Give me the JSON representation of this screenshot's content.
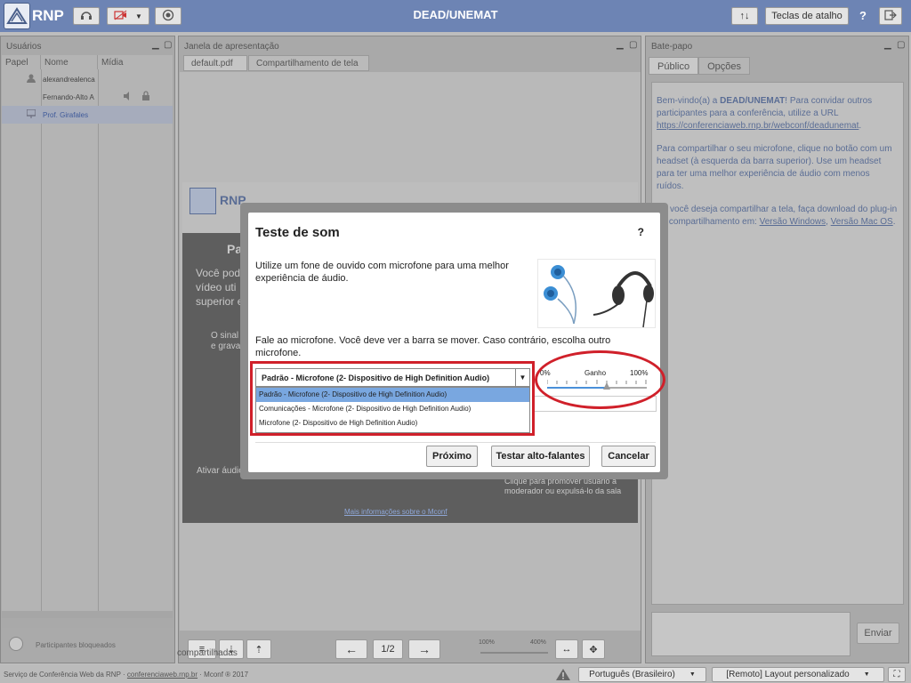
{
  "header": {
    "logo_text": "RNP",
    "title": "DEAD/UNEMAT",
    "shortcuts_label": "Teclas de atalho",
    "help_label": "?"
  },
  "users_panel": {
    "title": "Usuários",
    "columns": [
      "Papel",
      "Nome",
      "Mídia"
    ],
    "rows": [
      {
        "name": "alexandrealenca"
      },
      {
        "name": "Fernando-Alto A"
      },
      {
        "name": "Prof. Girafales"
      }
    ],
    "blocked_label": "Participantes bloqueados"
  },
  "presentation_panel": {
    "title": "Janela de apresentação",
    "tabs": [
      "default.pdf",
      "Compartilhamento de tela"
    ],
    "page_indicator": "1/2",
    "zoom_min": "100%",
    "zoom_max": "400%",
    "shared_label": "compartilhadas",
    "slide": {
      "logo_text": "RNP",
      "lines": [
        "Pa",
        "Você pode",
        "vídeo  uti",
        "superior e",
        "O sinal",
        "e grava",
        "Ativar áudio"
      ],
      "promote_text": "Clique para promover usuário a moderador ou expulsá-lo da sala",
      "more_info": "Mais informações sobre o Mconf"
    }
  },
  "chat_panel": {
    "title": "Bate-papo",
    "tabs": [
      "Público",
      "Opções"
    ],
    "welcome_prefix": "Bem-vindo(a) a ",
    "welcome_room": "DEAD/UNEMAT",
    "welcome_suffix": "! Para convidar outros participantes para a conferência, utilize a URL",
    "welcome_url": "https://conferenciaweb.rnp.br/webconf/deadunemat",
    "mic_tip": "Para compartilhar o seu microfone, clique no botão com um headset (à esquerda da barra superior). Use um headset para ter uma melhor experiência de áudio com menos ruídos.",
    "share_tip": "Se você deseja compartilhar a tela, faça download do plug-in de compartilhamento em:",
    "win_link": "Versão Windows",
    "mac_link": "Versão Mac OS",
    "send_label": "Enviar"
  },
  "footer": {
    "service_text": "Serviço de Conferência Web da RNP · ",
    "service_link": "conferenciaweb.rnp.br",
    "service_suffix": " · Mconf ® 2017",
    "language": "Português (Brasileiro)",
    "layout": "[Remoto] Layout personalizado"
  },
  "dialog": {
    "title": "Teste de som",
    "help": "?",
    "intro": "Utilize um fone de ouvido com microfone para uma melhor experiência de áudio.",
    "instruction": "Fale ao microfone. Você deve ver a barra se mover. Caso contrário, escolha outro microfone.",
    "selected_mic": "Padrão - Microfone (2- Dispositivo de High Definition Audio)",
    "mic_options": [
      "Padrão - Microfone (2- Dispositivo de High Definition Audio)",
      "Comunicações - Microfone (2- Dispositivo de High Definition Audio)",
      "Microfone (2- Dispositivo de High Definition Audio)"
    ],
    "gain_label": "Ganho",
    "gain_min": "0%",
    "gain_max": "100%",
    "gain_value": 0.6,
    "buttons": {
      "next": "Próximo",
      "test_speakers": "Testar alto-falantes",
      "cancel": "Cancelar"
    }
  },
  "colors": {
    "topbar": "#6d84b4",
    "highlight": "#d0202a",
    "selected_option": "#79a7e0"
  }
}
